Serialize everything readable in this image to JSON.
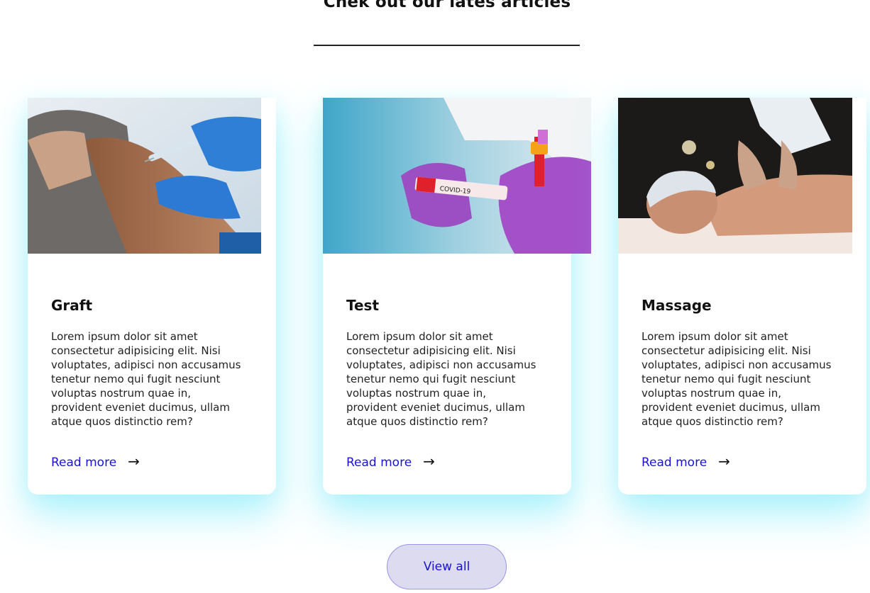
{
  "section": {
    "title": "Chek out our lates articles"
  },
  "articles": [
    {
      "title": "Graft",
      "image": "vaccination-photo",
      "text": "Lorem ipsum dolor sit amet consectetur adipisicing elit. Nisi voluptates, adipisci non accusamus tenetur nemo qui fugit nesciunt voluptas nostrum quae in, provident eveniet ducimus, ullam atque quos distinctio rem?",
      "link_label": "Read more",
      "link_icon": "arrow-right-icon"
    },
    {
      "title": "Test",
      "image": "covid-test-tube-photo",
      "image_text": "COVID-19",
      "text": "Lorem ipsum dolor sit amet consectetur adipisicing elit. Nisi voluptates, adipisci non accusamus tenetur nemo qui fugit nesciunt voluptas nostrum quae in, provident eveniet ducimus, ullam atque quos distinctio rem?",
      "link_label": "Read more",
      "link_icon": "arrow-right-icon"
    },
    {
      "title": "Massage",
      "image": "massage-photo",
      "text": "Lorem ipsum dolor sit amet consectetur adipisicing elit. Nisi voluptates, adipisci non accusamus tenetur nemo qui fugit nesciunt voluptas nostrum quae in, provident eveniet ducimus, ullam atque quos distinctio rem?",
      "link_label": "Read more",
      "link_icon": "arrow-right-icon"
    }
  ],
  "view_all": {
    "label": "View all"
  },
  "colors": {
    "link": "#1a12d4",
    "card_shadow": "#8ff0fa",
    "button_bg": "#dcdbf0",
    "button_border": "#9a95e6"
  }
}
